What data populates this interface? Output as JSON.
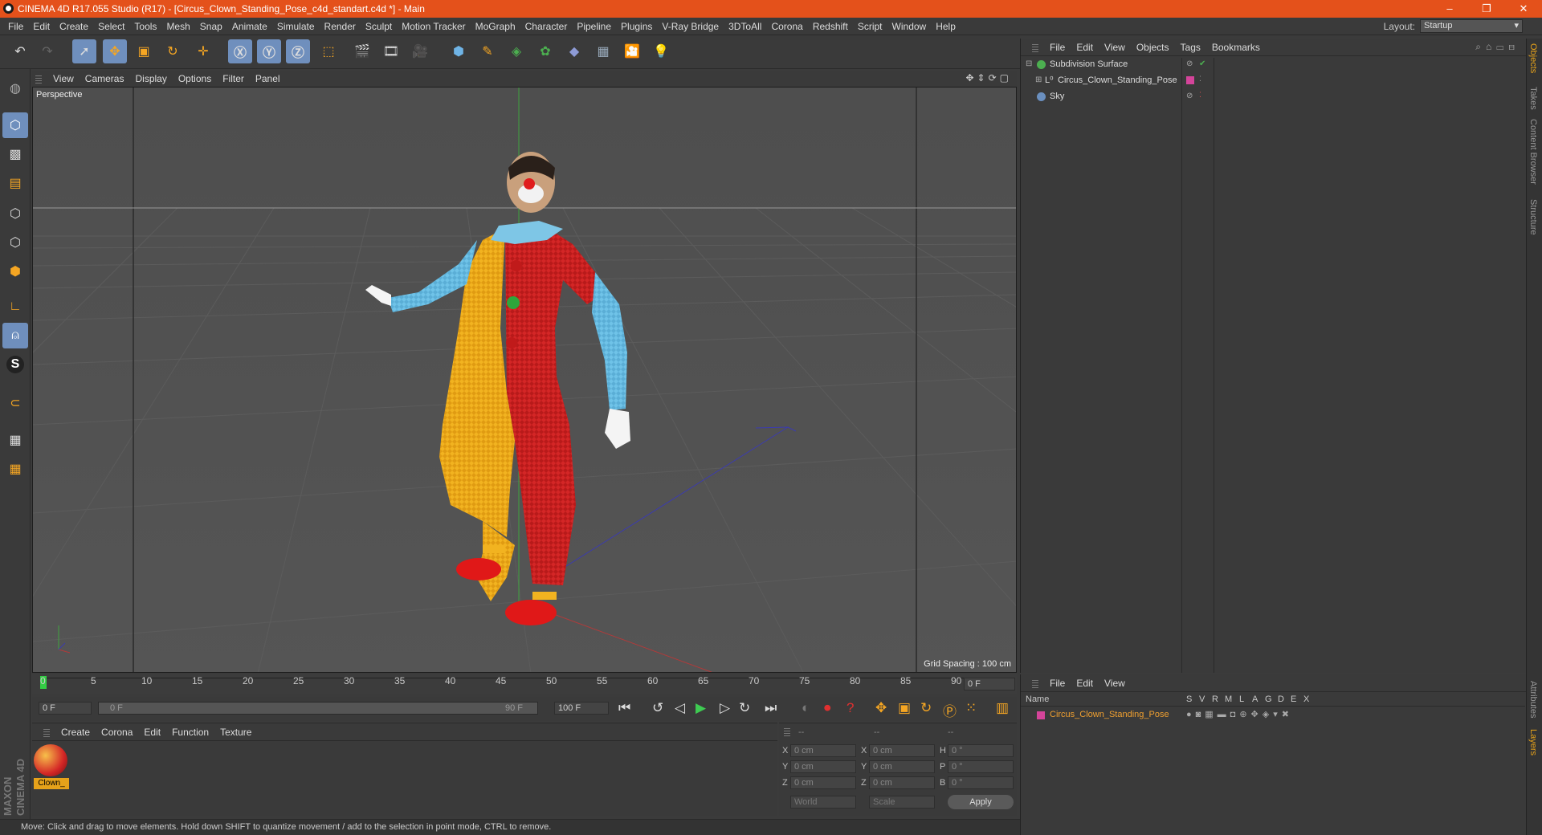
{
  "window": {
    "title": "CINEMA 4D R17.055 Studio (R17) - [Circus_Clown_Standing_Pose_c4d_standart.c4d *] - Main",
    "minimize": "–",
    "maximize": "❐",
    "close": "✕"
  },
  "menubar": {
    "items": [
      "File",
      "Edit",
      "Create",
      "Select",
      "Tools",
      "Mesh",
      "Snap",
      "Animate",
      "Simulate",
      "Render",
      "Sculpt",
      "Motion Tracker",
      "MoGraph",
      "Character",
      "Pipeline",
      "Plugins",
      "V-Ray Bridge",
      "3DToAll",
      "Corona",
      "Redshift",
      "Script",
      "Window",
      "Help"
    ],
    "layout_label": "Layout:",
    "layout_value": "Startup"
  },
  "viewport": {
    "menu": [
      "View",
      "Cameras",
      "Display",
      "Options",
      "Filter",
      "Panel"
    ],
    "camera_label": "Perspective",
    "grid_spacing": "Grid Spacing : 100 cm"
  },
  "timeline": {
    "ticks": [
      "0",
      "5",
      "10",
      "15",
      "20",
      "25",
      "30",
      "35",
      "40",
      "45",
      "50",
      "55",
      "60",
      "65",
      "70",
      "75",
      "80",
      "85",
      "90"
    ],
    "current_frame": "0 F"
  },
  "transport": {
    "start_field": "0 F",
    "range_start": "0 F",
    "range_end": "90 F",
    "end_field": "100 F"
  },
  "material_panel": {
    "menu": [
      "Create",
      "Corona",
      "Edit",
      "Function",
      "Texture"
    ],
    "material_name": "Clown_"
  },
  "coord_panel": {
    "header": [
      "--",
      "--",
      "--"
    ],
    "rows": [
      {
        "a": "X",
        "av": "0 cm",
        "b": "X",
        "bv": "0 cm",
        "c": "H",
        "cv": "0 °"
      },
      {
        "a": "Y",
        "av": "0 cm",
        "b": "Y",
        "bv": "0 cm",
        "c": "P",
        "cv": "0 °"
      },
      {
        "a": "Z",
        "av": "0 cm",
        "b": "Z",
        "bv": "0 cm",
        "c": "B",
        "cv": "0 °"
      }
    ],
    "mode1": "World",
    "mode2": "Scale",
    "apply": "Apply"
  },
  "status": "Move: Click and drag to move elements. Hold down SHIFT to quantize movement / add to the selection in point mode, CTRL to remove.",
  "object_manager": {
    "menu": [
      "File",
      "Edit",
      "View",
      "Objects",
      "Tags",
      "Bookmarks"
    ],
    "objects": [
      {
        "name": "Subdivision Surface",
        "color": "#4caf50"
      },
      {
        "name": "Circus_Clown_Standing_Pose",
        "color": "#d4449a"
      },
      {
        "name": "Sky",
        "color": "#6a8fbf"
      }
    ]
  },
  "layer_manager": {
    "menu": [
      "File",
      "Edit",
      "View"
    ],
    "name_header": "Name",
    "columns": [
      "S",
      "V",
      "R",
      "M",
      "L",
      "A",
      "G",
      "D",
      "E",
      "X"
    ],
    "layer_name": "Circus_Clown_Standing_Pose",
    "layer_color": "#d4449a"
  },
  "right_tabs": [
    "Objects",
    "Takes",
    "Content Browser",
    "Structure"
  ],
  "right_tabs_bottom": [
    "Attributes",
    "Layers"
  ],
  "brand": "MAXON CINEMA 4D"
}
